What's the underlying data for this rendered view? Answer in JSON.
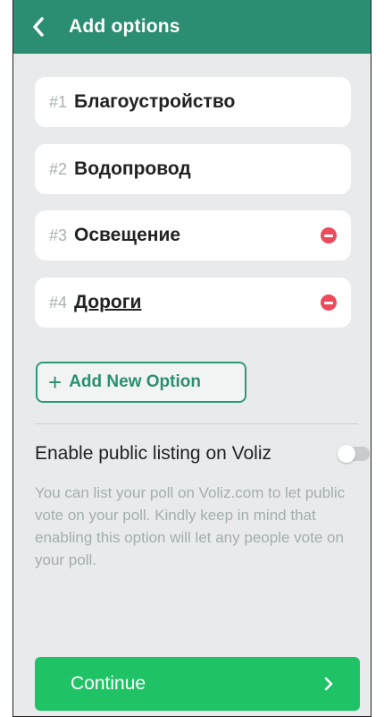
{
  "header": {
    "back_icon": "chevron-left-icon",
    "title": "Add options"
  },
  "options": [
    {
      "number": "#1",
      "label": "Благоустройство",
      "removable": false
    },
    {
      "number": "#2",
      "label": "Водопровод",
      "removable": false
    },
    {
      "number": "#3",
      "label": "Освещение",
      "removable": true
    },
    {
      "number": "#4",
      "label": "Дороги",
      "removable": true
    }
  ],
  "add_option": {
    "icon": "+",
    "label": "Add New Option"
  },
  "public_listing": {
    "title": "Enable public listing on Voliz",
    "enabled": false,
    "description": "You can list your poll on Voliz.com to let public vote on your poll. Kindly keep in mind that enabling this option will let any people vote on your poll."
  },
  "continue_button": {
    "label": "Continue",
    "icon": "chevron-right-icon"
  },
  "colors": {
    "header": "#2b8e72",
    "accent_green": "#1fc265",
    "remove_red": "#ee4a5c",
    "background": "#e9eaec"
  }
}
